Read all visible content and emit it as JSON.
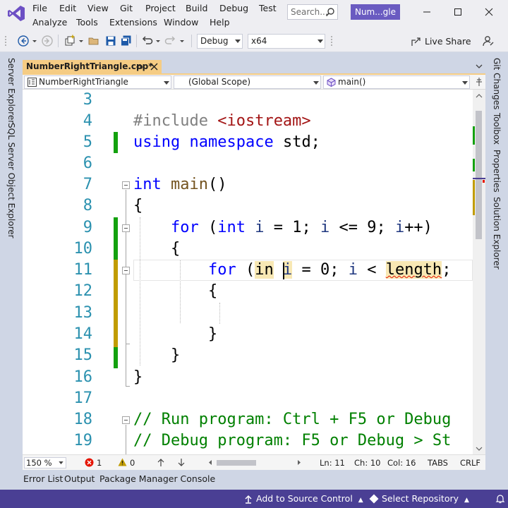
{
  "app": {
    "search_placeholder": "Search...",
    "solution_name": "Num...gle"
  },
  "menu": {
    "file": "File",
    "edit": "Edit",
    "view": "View",
    "git": "Git",
    "project": "Project",
    "build": "Build",
    "debug": "Debug",
    "test": "Test",
    "analyze": "Analyze",
    "tools": "Tools",
    "extensions": "Extensions",
    "window": "Window",
    "help": "Help"
  },
  "toolbar": {
    "configuration": "Debug",
    "platform": "x64",
    "live_share": "Live Share"
  },
  "left_rail": {
    "server_explorer": "Server Explorer",
    "sql_explorer": "SQL Server Object Explorer"
  },
  "right_rail": {
    "git_changes": "Git Changes",
    "toolbox": "Toolbox",
    "properties": "Properties",
    "solution_explorer": "Solution Explorer"
  },
  "document_tab": {
    "name": "NumberRightTriangle.cpp*"
  },
  "navigation": {
    "project": "NumberRightTriangle",
    "scope": "(Global Scope)",
    "member": "main()"
  },
  "editor": {
    "line_numbers": [
      "3",
      "4",
      "5",
      "6",
      "7",
      "8",
      "9",
      "10",
      "11",
      "12",
      "13",
      "14",
      "15",
      "16",
      "17",
      "18",
      "19"
    ],
    "code": {
      "l4_directive": "#include",
      "l4_header": "<iostream>",
      "l5_using": "using",
      "l5_namespace": "namespace",
      "l5_rest": " std;",
      "l7_int": "int",
      "l7_main": "main",
      "l7_parens": "()",
      "l8": "{",
      "l9_for": "for",
      "l9_open": " (",
      "l9_int": "int",
      "l9_i1": "i",
      "l9_mid1": " = 1; ",
      "l9_i2": "i",
      "l9_mid2": " <= 9; ",
      "l9_i3": "i",
      "l9_end": "++)",
      "l10": "{",
      "l11_for": "for",
      "l11_open": " (",
      "l11_in": "in",
      "l11_space": " ",
      "l11_i1": "i",
      "l11_mid1": " = 0; ",
      "l11_i2": "i",
      "l11_mid2": " < ",
      "l11_length": "length",
      "l11_end": ";",
      "l12": "{",
      "l14": "}",
      "l15": "}",
      "l16": "}",
      "l18": "// Run program: Ctrl + F5 or Debug",
      "l19": "// Debug program: F5 or Debug > St"
    }
  },
  "editor_status": {
    "zoom": "150 %",
    "errors": "1",
    "warnings": "0",
    "line": "Ln: 11",
    "col": "Ch: 10",
    "column": "Col: 16",
    "indent": "TABS",
    "eol": "CRLF"
  },
  "bottom_tabs": {
    "error_list": "Error List",
    "output": "Output",
    "package_manager": "Package Manager Console"
  },
  "statusbar": {
    "source_control": "Add to Source Control",
    "repository": "Select Repository"
  },
  "colors": {
    "accent": "#4a3f94",
    "tab_active": "#f5cc84",
    "saved_change": "#13a10e",
    "unsaved_change": "#c19c00",
    "error": "#e51400"
  }
}
